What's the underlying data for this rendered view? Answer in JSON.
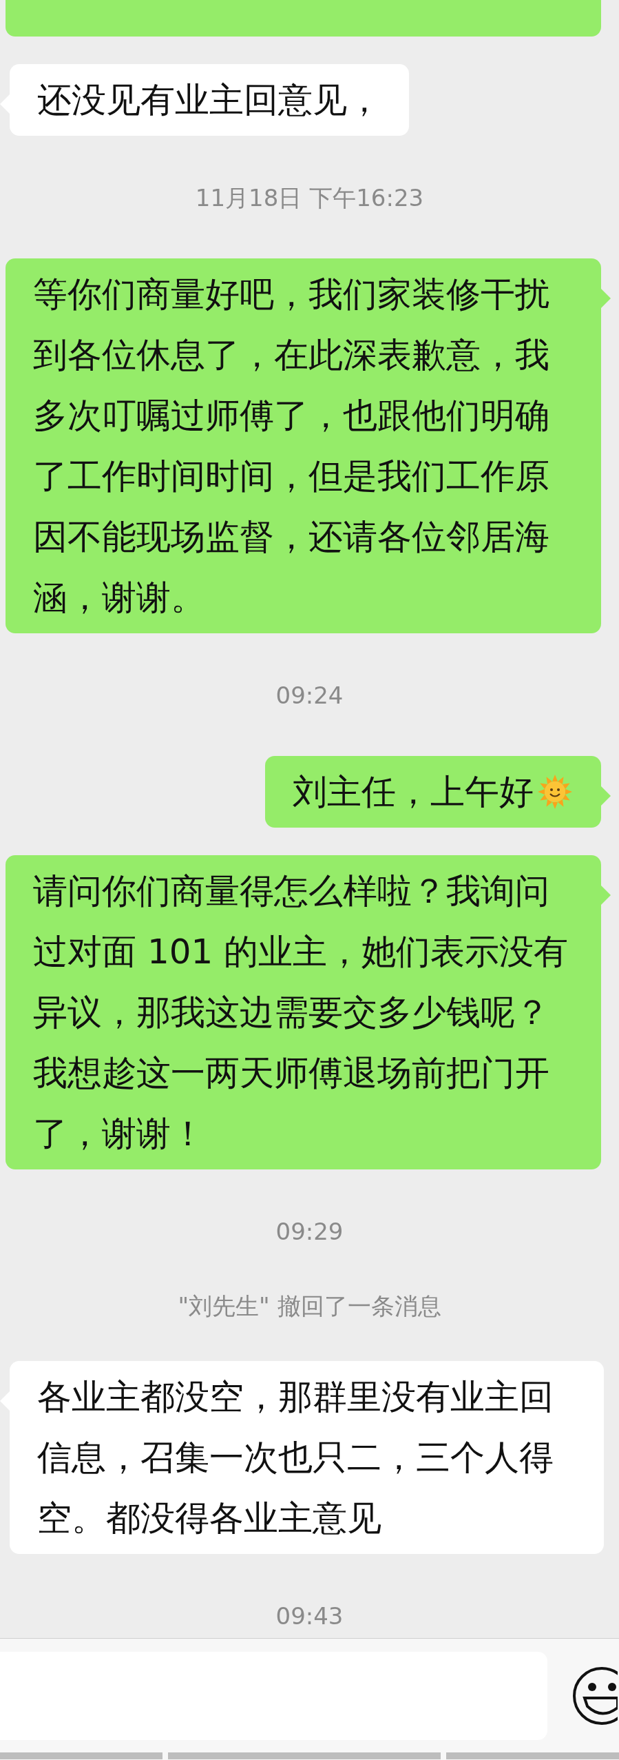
{
  "messages": [
    {
      "kind": "edge",
      "outgoing": true
    },
    {
      "kind": "bubble",
      "outgoing": false,
      "text": "还没见有业主回意见，",
      "emoji": false
    },
    {
      "kind": "time",
      "text": "11月18日 下午16:23"
    },
    {
      "kind": "bubble",
      "outgoing": true,
      "text": "等你们商量好吧，我们家装修干扰到各位休息了，在此深表歉意，我多次叮嘱过师傅了，也跟他们明确了工作时间时间，但是我们工作原因不能现场监督，还请各位邻居海涵，谢谢。",
      "emoji": false
    },
    {
      "kind": "time",
      "text": "09:24"
    },
    {
      "kind": "bubble",
      "outgoing": true,
      "text": "刘主任，上午好",
      "emoji": true
    },
    {
      "kind": "bubble",
      "outgoing": true,
      "text": "请问你们商量得怎么样啦？我询问过对面 101 的业主，她们表示没有异议，那我这边需要交多少钱呢？我想趁这一两天师傅退场前把门开了，谢谢！",
      "emoji": false
    },
    {
      "kind": "time",
      "text": "09:29"
    },
    {
      "kind": "recall",
      "text": "\"刘先生\" 撤回了一条消息"
    },
    {
      "kind": "bubble",
      "outgoing": false,
      "text": "各业主都没空，那群里没有业主回信息，召集一次也只二，三个人得空。都没得各业主意见",
      "emoji": false
    },
    {
      "kind": "time",
      "text": "09:43"
    }
  ]
}
